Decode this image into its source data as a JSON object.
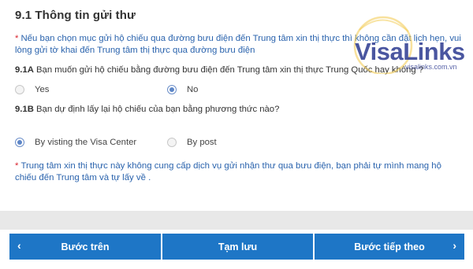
{
  "section": {
    "title": "9.1 Thông tin gửi thư",
    "note1": {
      "marker": "*",
      "text": "Nếu bạn chọn mục gửi hộ chiếu qua đường bưu điện đến Trung tâm xin thị thực thì không cần đặt lịch hẹn, vui lòng gửi tờ khai đến Trung tâm thị thực qua đường bưu điện"
    },
    "q1": {
      "code": "9.1A",
      "text": "Bạn muốn gửi hộ chiếu bằng đường bưu điện đến Trung tâm xin thị thực Trung Quốc hay không ?",
      "options": [
        "Yes",
        "No"
      ],
      "selected": "No"
    },
    "q2": {
      "code": "9.1B",
      "text": "Bạn dự định lấy lại hộ chiếu của bạn bằng phương thức nào?",
      "options": [
        "By visting the Visa Center",
        "By post"
      ],
      "selected": "By visting the Visa Center"
    },
    "note2": {
      "marker": "*",
      "text": "Trung tâm xin thị thực này không cung cấp dịch vụ gửi nhận thư qua bưu điện, bạn phải tự mình mang hộ chiếu đến Trung tâm và tự lấy về ."
    }
  },
  "buttons": {
    "back_label": "Bước trên",
    "save_label": "Tạm lưu",
    "next_label": "Bước tiếp theo",
    "back_icon": "chevron-left-icon",
    "next_icon": "chevron-right-icon",
    "color": "#1e76c6"
  },
  "watermark": {
    "logo_text": "VisaLinks",
    "url": "visalinks.com.vn"
  },
  "colors": {
    "note_text": "#2a63ad",
    "required_marker": "#d9232d",
    "radio_selected": "#5d86c7"
  }
}
